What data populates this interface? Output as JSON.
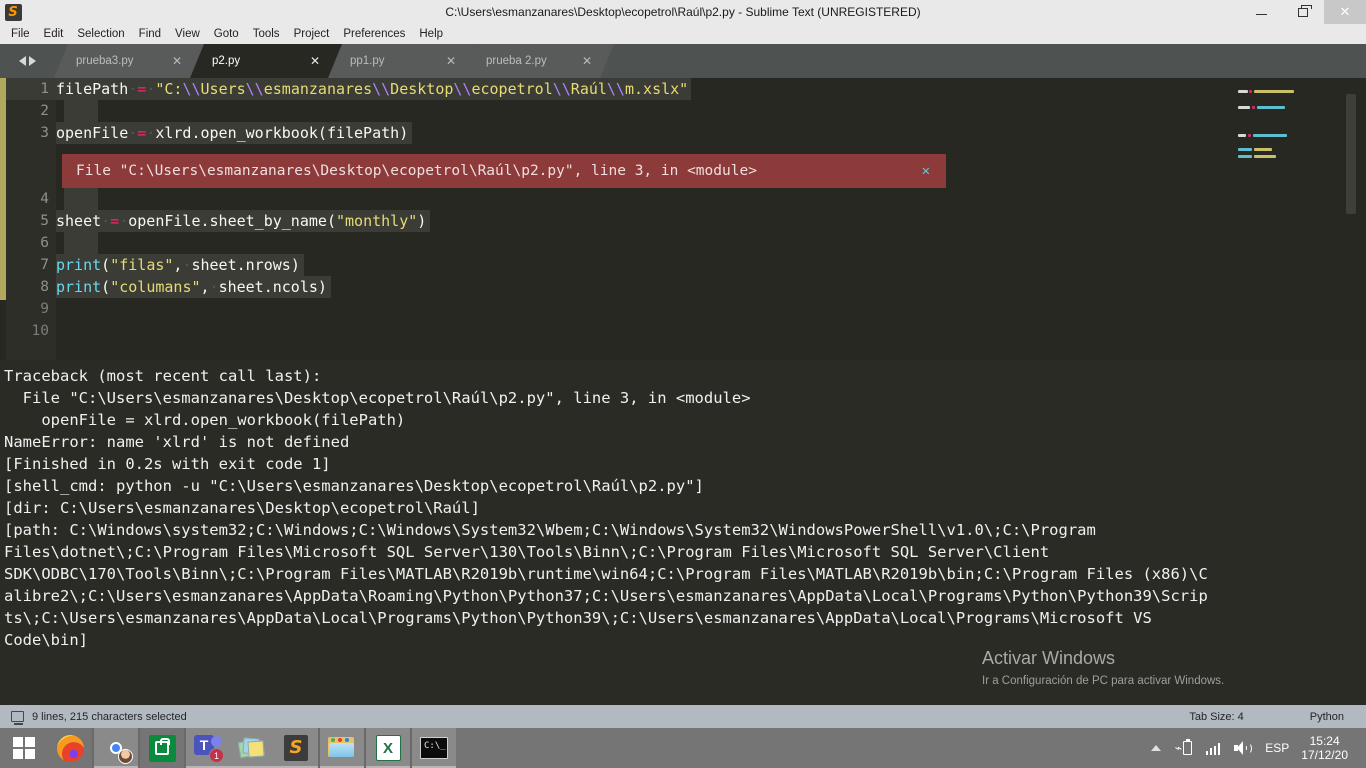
{
  "window": {
    "title": "C:\\Users\\esmanzanares\\Desktop\\ecopetrol\\Raúl\\p2.py - Sublime Text (UNREGISTERED)",
    "app_logo_glyph": "S",
    "controls": {
      "minimize": "minimize-icon",
      "maximize": "maximize-icon",
      "close": "✕"
    }
  },
  "menu": {
    "items": [
      {
        "label": "File"
      },
      {
        "label": "Edit"
      },
      {
        "label": "Selection"
      },
      {
        "label": "Find"
      },
      {
        "label": "View"
      },
      {
        "label": "Goto"
      },
      {
        "label": "Tools"
      },
      {
        "label": "Project"
      },
      {
        "label": "Preferences"
      },
      {
        "label": "Help"
      }
    ]
  },
  "tabs": {
    "close_glyph": "✕",
    "items": [
      {
        "label": "prueba3.py",
        "active": false
      },
      {
        "label": "p2.py",
        "active": true
      },
      {
        "label": "pp1.py",
        "active": false
      },
      {
        "label": "prueba 2.py",
        "active": false
      }
    ]
  },
  "editor": {
    "line_numbers": [
      "1",
      "2",
      "3",
      "4",
      "5",
      "6",
      "7",
      "8",
      "9",
      "10"
    ],
    "lines": [
      {
        "num": "1",
        "text": "filePath = \"C:\\\\Users\\\\esmanzanares\\\\Desktop\\\\ecopetrol\\\\Raúl\\\\m.xslx\""
      },
      {
        "num": "2",
        "text": ""
      },
      {
        "num": "3",
        "text": "openFile = xlrd.open_workbook(filePath)"
      },
      {
        "num": "4",
        "text": ""
      },
      {
        "num": "5",
        "text": "sheet = openFile.sheet_by_name(\"monthly\")"
      },
      {
        "num": "6",
        "text": ""
      },
      {
        "num": "7",
        "text": "print(\"filas\", sheet.nrows)"
      },
      {
        "num": "8",
        "text": "print(\"columans\", sheet.ncols)"
      },
      {
        "num": "9",
        "text": ""
      },
      {
        "num": "10",
        "text": ""
      }
    ],
    "inline_error": {
      "message": "File \"C:\\Users\\esmanzanares\\Desktop\\ecopetrol\\Raúl\\p2.py\", line 3, in <module>",
      "close_glyph": "✕"
    }
  },
  "console": {
    "lines": [
      "Traceback (most recent call last):",
      "  File \"C:\\Users\\esmanzanares\\Desktop\\ecopetrol\\Raúl\\p2.py\", line 3, in <module>",
      "    openFile = xlrd.open_workbook(filePath)",
      "NameError: name 'xlrd' is not defined",
      "[Finished in 0.2s with exit code 1]",
      "[shell_cmd: python -u \"C:\\Users\\esmanzanares\\Desktop\\ecopetrol\\Raúl\\p2.py\"]",
      "[dir: C:\\Users\\esmanzanares\\Desktop\\ecopetrol\\Raúl]",
      "[path: C:\\Windows\\system32;C:\\Windows;C:\\Windows\\System32\\Wbem;C:\\Windows\\System32\\WindowsPowerShell\\v1.0\\;C:\\Program",
      "Files\\dotnet\\;C:\\Program Files\\Microsoft SQL Server\\130\\Tools\\Binn\\;C:\\Program Files\\Microsoft SQL Server\\Client",
      "SDK\\ODBC\\170\\Tools\\Binn\\;C:\\Program Files\\MATLAB\\R2019b\\runtime\\win64;C:\\Program Files\\MATLAB\\R2019b\\bin;C:\\Program Files (x86)\\C",
      "alibre2\\;C:\\Users\\esmanzanares\\AppData\\Roaming\\Python\\Python37;C:\\Users\\esmanzanares\\AppData\\Local\\Programs\\Python\\Python39\\Scrip",
      "ts\\;C:\\Users\\esmanzanares\\AppData\\Local\\Programs\\Python\\Python39\\;C:\\Users\\esmanzanares\\AppData\\Local\\Programs\\Microsoft VS",
      "Code\\bin]"
    ]
  },
  "watermark": {
    "title": "Activar Windows",
    "subtitle": "Ir a Configuración de PC para activar Windows."
  },
  "statusbar": {
    "selection": "9 lines, 215 characters selected",
    "tab_size": "Tab Size: 4",
    "syntax": "Python"
  },
  "taskbar": {
    "start": "start-button",
    "apps": [
      {
        "name": "firefox",
        "open": false
      },
      {
        "name": "chrome",
        "open": true
      },
      {
        "name": "microsoft-store",
        "open": false
      },
      {
        "name": "microsoft-teams",
        "open": true,
        "badge": "1"
      },
      {
        "name": "sticky-notes",
        "open": true
      },
      {
        "name": "sublime-text",
        "open": true
      },
      {
        "name": "file-explorer",
        "open": true
      },
      {
        "name": "excel",
        "open": true
      },
      {
        "name": "command-prompt",
        "open": true
      }
    ],
    "tray": {
      "language": "ESP",
      "time": "15:24",
      "date": "17/12/20"
    }
  },
  "colors": {
    "editor_bg": "#272822",
    "gutter_bg": "#2d2e28",
    "selection": "#3b3c36",
    "error_bg": "#8c3a3a",
    "string": "#e6db74",
    "operator": "#f92672",
    "function": "#66d9ef",
    "escape": "#ae81ff",
    "status_bg": "#b3b9c0",
    "taskbar_bg": "#757575"
  }
}
